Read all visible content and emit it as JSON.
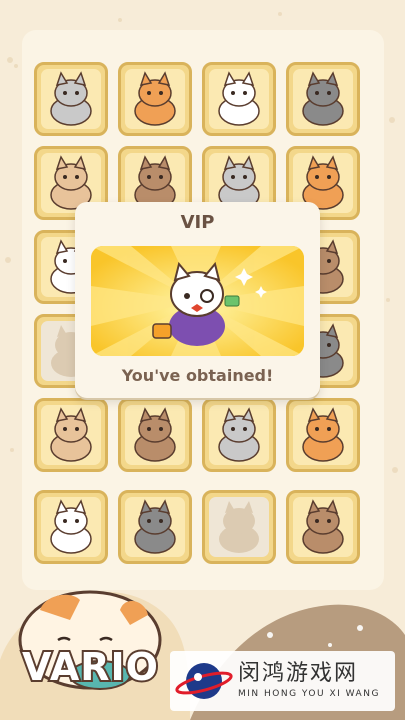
{
  "popup": {
    "title": "VIP",
    "message": "You've obtained!"
  },
  "banner_text": "VARIO",
  "watermark": {
    "cn": "闵鸿游戏网",
    "en": "MIN HONG YOU XI WANG"
  },
  "colors": {
    "background": "#f7ecd8",
    "card_fill": "#f3d78a",
    "card_border": "#d9b35b",
    "vip_yellow": "#fbd84a",
    "text_brown": "#6a5243"
  },
  "grid": {
    "cards": [
      {
        "name": "cat-red-hood"
      },
      {
        "name": "cat-gray-raccoon"
      },
      {
        "name": "cat-batman"
      },
      {
        "name": "cat-orange-tabby"
      },
      {
        "name": "cat-clown-king"
      },
      {
        "name": "cat-white-fluffy"
      },
      {
        "name": "cat-glasses-hat"
      },
      {
        "name": "cat-superhero"
      },
      {
        "name": "cat-orange-shy"
      },
      {
        "name": "cat-hidden-2"
      },
      {
        "name": "cat-hidden-3"
      },
      {
        "name": "cat-panda"
      },
      {
        "name": "cat-silhouette"
      },
      {
        "name": "cat-hidden-4"
      },
      {
        "name": "cat-hidden-5"
      },
      {
        "name": "cat-white-calico"
      },
      {
        "name": "cat-gray-white"
      },
      {
        "name": "cat-sunglasses-hawaii"
      },
      {
        "name": "cat-pirate"
      },
      {
        "name": "cat-gray-tabby"
      },
      {
        "name": "cat-orange-striped"
      },
      {
        "name": "cat-silver-tabby"
      },
      {
        "name": "cat-silhouette-2"
      },
      {
        "name": "cat-brown-tabby"
      }
    ]
  }
}
